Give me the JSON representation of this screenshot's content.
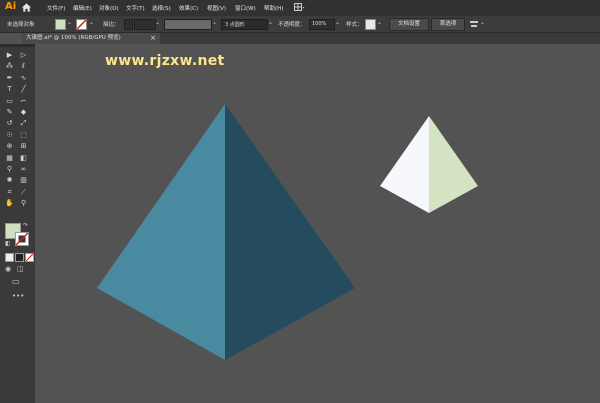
{
  "menubar": {
    "logo": "Ai",
    "items": [
      "文件(F)",
      "编辑(E)",
      "对象(O)",
      "文字(T)",
      "选择(S)",
      "效果(C)",
      "视图(V)",
      "窗口(W)",
      "帮助(H)"
    ]
  },
  "controlbar": {
    "selection_label": "未选择对象",
    "stroke_label": "描边：",
    "stroke_style": "3 点圆形",
    "opacity_label": "不透明度：",
    "opacity_value": "100%",
    "style_label": "样式：",
    "doc_setup": "文档设置",
    "preferences": "首选项",
    "fill_color": "#cfe0c2",
    "stroke_none_color": "#d02020"
  },
  "tab": {
    "title": "大锥图.ai* @ 100% (RGB/GPU 预览)",
    "close": "×"
  },
  "watermark": "www.rjzxw.net",
  "canvas": {
    "background": "#535353",
    "large_pyramid": {
      "left_face": "#4a8aa0",
      "right_face": "#254b5e"
    },
    "small_pyramid": {
      "left_face": "#f6f8fc",
      "right_face": "#d4e3c2"
    }
  },
  "tools": {
    "icons": [
      "selection-tool-icon",
      "direct-selection-tool-icon",
      "magic-wand-icon",
      "lasso-icon",
      "pen-tool-icon",
      "curvature-tool-icon",
      "type-tool-icon",
      "line-tool-icon",
      "rectangle-tool-icon",
      "paintbrush-icon",
      "pencil-icon",
      "eraser-icon",
      "rotate-tool-icon",
      "scale-tool-icon",
      "warp-tool-icon",
      "free-transform-icon",
      "shape-builder-icon",
      "perspective-grid-icon",
      "mesh-tool-icon",
      "gradient-tool-icon",
      "eyedropper-icon",
      "blend-tool-icon",
      "symbol-sprayer-icon",
      "graph-tool-icon",
      "artboard-tool-icon",
      "slice-tool-icon",
      "hand-tool-icon",
      "zoom-tool-icon"
    ],
    "more": "•••",
    "fill_color": "#cfe0c2"
  }
}
